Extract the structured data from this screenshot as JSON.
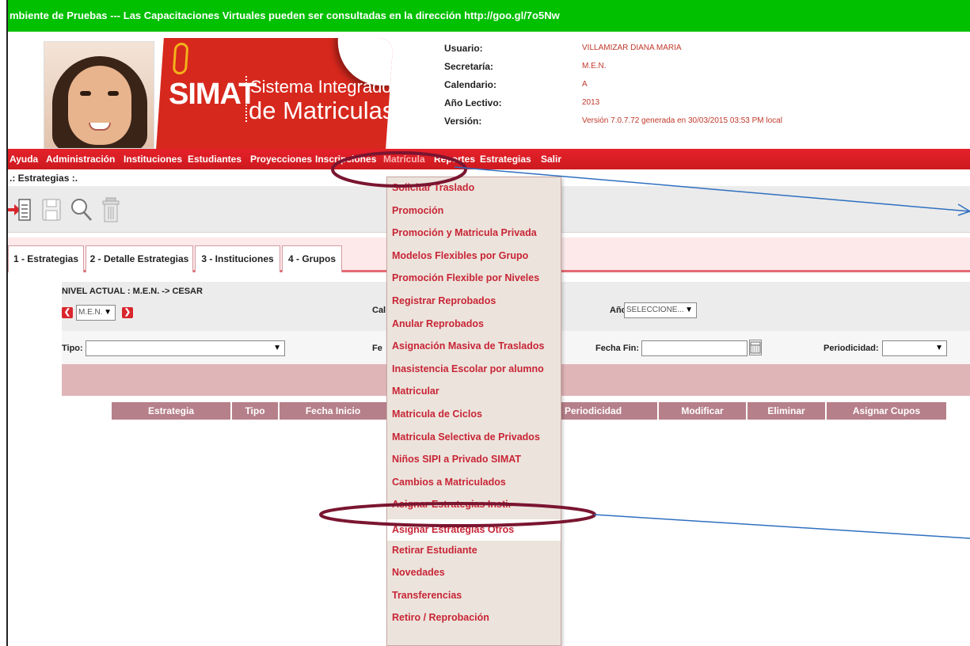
{
  "banner": {
    "text": "mbiente de Pruebas --- Las Capacitaciones Virtuales pueden ser consultadas en la dirección http://goo.gl/7o5Nw"
  },
  "logo": {
    "word": "SIMAT",
    "line1": "Sistema Integrado",
    "line2": "de Matriculas"
  },
  "user_info": {
    "items": [
      {
        "label": "Usuario:",
        "value": "VILLAMIZAR DIANA MARIA"
      },
      {
        "label": "Secretaría:",
        "value": "M.E.N."
      },
      {
        "label": "Calendario:",
        "value": "A"
      },
      {
        "label": "Año Lectivo:",
        "value": "2013"
      },
      {
        "label": "Versión:",
        "value": "Versión 7.0.7.72 generada en 30/03/2015 03:53 PM local"
      }
    ]
  },
  "menubar": {
    "items": [
      "Ayuda",
      "Administración",
      "Instituciones",
      "Estudiantes",
      "Proyecciones",
      "Inscripciones",
      "Matrícula",
      "Reportes",
      "Estrategias",
      "Salir"
    ],
    "active": "Matrícula"
  },
  "breadcrumb": ".: Estrategias :.",
  "toolbar": {
    "icons": [
      "new-document-icon",
      "save-icon",
      "search-icon",
      "delete-icon"
    ]
  },
  "tabs": [
    "1 - Estrategias",
    "2 - Detalle Estrategias",
    "3 - Instituciones",
    "4 - Grupos"
  ],
  "filters": {
    "nivel_actual": "NIVEL ACTUAL : M.E.N. -> CESAR",
    "nivel_select": "M.E.N.",
    "cal_label": "Cal",
    "anio_label": "Año",
    "anio_select": "SELECCIONE...",
    "tipo_label": "Tipo:",
    "tipo_value": "",
    "fecha_inicio_label": "Fe",
    "fecha_fin_label": "Fecha Fin:",
    "fecha_fin_value": "",
    "periodicidad_label": "Periodicidad:",
    "periodicidad_value": ""
  },
  "table": {
    "headers": [
      "Estrategia",
      "Tipo",
      "Fecha Inicio",
      "Periodicidad",
      "Modificar",
      "Eliminar",
      "Asignar Cupos"
    ]
  },
  "dropdown": {
    "items": [
      "Solicitar Traslado",
      "Promoción",
      "Promoción y Matricula Privada",
      "Modelos Flexibles por Grupo",
      "Promoción Flexible por Niveles",
      "Registrar Reprobados",
      "Anular Reprobados",
      "Asignación Masiva de Traslados",
      "Inasistencia Escolar por alumno",
      "Matricular",
      "Matricula de Ciclos",
      "Matricula Selectiva de Privados",
      "Niños SIPI a Privado SIMAT",
      "Cambios a Matriculados",
      "Asignar Estrategias Insti.",
      "Asignar Estrategias Otros",
      "Retirar Estudiante",
      "Novedades",
      "Transferencias",
      "Retiro / Reprobación"
    ],
    "hovered": "Asignar Estrategias Otros"
  },
  "colors": {
    "banner": "#00c000",
    "menubar": "#e5212a",
    "menu_text": "#c82536",
    "annotation_ellipse": "#7a1530",
    "annotation_line": "#2f6fc0"
  }
}
